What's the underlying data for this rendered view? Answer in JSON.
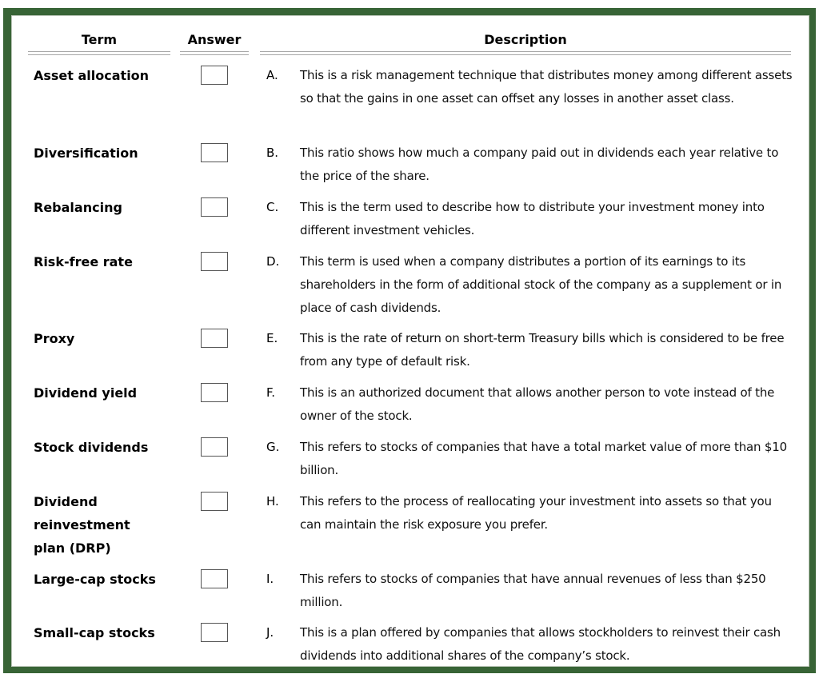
{
  "headers": {
    "term": "Term",
    "answer": "Answer",
    "description": "Description"
  },
  "colors": {
    "frame": "#386436",
    "rule": "#a8a8a8"
  },
  "rows": [
    {
      "term": "Asset allocation",
      "letter": "A.",
      "description": "This is a risk management technique that distributes money among different assets so that the gains in one asset can offset any losses in another asset class.",
      "answer": ""
    },
    {
      "term": "Diversification",
      "letter": "B.",
      "description": "This ratio shows how much a company paid out in dividends each year relative to the price of the share.",
      "answer": ""
    },
    {
      "term": "Rebalancing",
      "letter": "C.",
      "description": "This is the term used to describe how to distribute your investment money into different investment vehicles.",
      "answer": ""
    },
    {
      "term": "Risk-free rate",
      "letter": "D.",
      "description": "This term is used when a company distributes a portion of its earnings to its shareholders in the form of additional stock of the company as a supplement or in place of cash dividends.",
      "answer": ""
    },
    {
      "term": "Proxy",
      "letter": "E.",
      "description": "This is the rate of return on short-term Treasury bills which is considered to be free from any type of default risk.",
      "answer": ""
    },
    {
      "term": "Dividend yield",
      "letter": "F.",
      "description": "This is an authorized document that allows another person to vote instead of the owner of the stock.",
      "answer": ""
    },
    {
      "term": "Stock dividends",
      "letter": "G.",
      "description": "This refers to stocks of companies that have a total market value of more than $10 billion.",
      "answer": ""
    },
    {
      "term": "Dividend reinvestment plan (DRP)",
      "letter": "H.",
      "description": "This refers to the process of reallocating your investment into assets so that you can maintain the risk exposure you prefer.",
      "answer": ""
    },
    {
      "term": "Large-cap stocks",
      "letter": "I.",
      "description": "This refers to stocks of companies that have annual revenues of less than $250 million.",
      "answer": ""
    },
    {
      "term": "Small-cap stocks",
      "letter": "J.",
      "description": "This is a plan offered by companies that allows stockholders to reinvest their cash dividends into additional shares of the company’s stock.",
      "answer": ""
    }
  ]
}
